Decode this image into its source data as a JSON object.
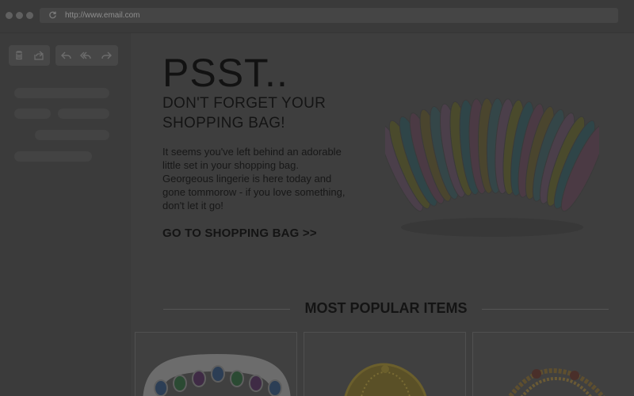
{
  "browser": {
    "url": "http://www.email.com",
    "icons": {
      "refresh": "refresh-icon"
    }
  },
  "sidebar": {
    "toolbar": [
      {
        "name": "trash-icon",
        "label": "Delete"
      },
      {
        "name": "share-icon",
        "label": "Share"
      },
      {
        "name": "reply-icon",
        "label": "Reply"
      },
      {
        "name": "reply-all-icon",
        "label": "Reply all"
      },
      {
        "name": "forward-icon",
        "label": "Forward"
      }
    ]
  },
  "email": {
    "headline": "PSST..",
    "subheadline": "DON'T FORGET YOUR SHOPPING BAG!",
    "body": "It seems you've left behind an adorable little set in your shopping bag. Georgeous lingerie is here today and gone tommorow - if you love something, don't let it go!",
    "cta": "GO TO SHOPPING BAG >>",
    "popular_heading": "MOST POPULAR ITEMS"
  },
  "colors": {
    "overlay_background": "#3d3d3d",
    "text": "#141414"
  }
}
